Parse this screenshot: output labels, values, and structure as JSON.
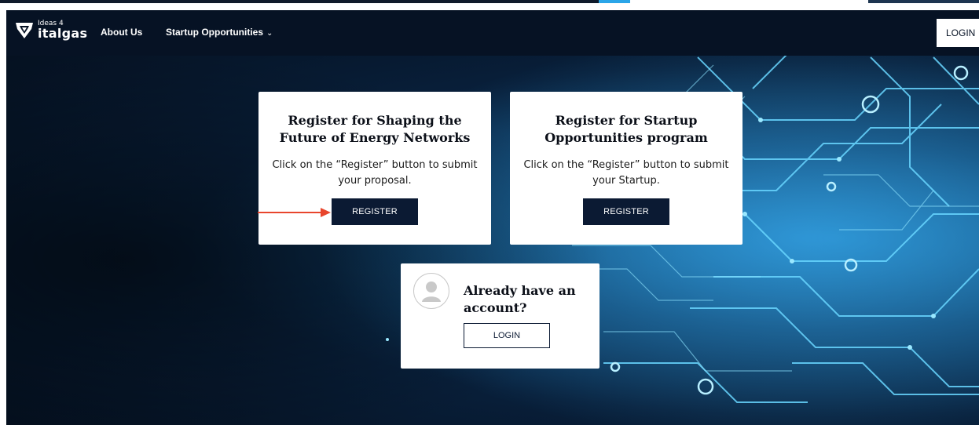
{
  "brand": {
    "logo_small": "Ideas 4",
    "logo_main": "italgas"
  },
  "nav": {
    "about": "About Us",
    "startup": "Startup Opportunities",
    "startup_caret": "⌄",
    "login": "LOGIN"
  },
  "cards": [
    {
      "title": "Register for Shaping the Future of Energy Networks",
      "description": "Click on the “Register” button to submit your proposal.",
      "button": "REGISTER"
    },
    {
      "title": "Register for Startup Opportunities program",
      "description": "Click on the “Register” button to submit your Startup.",
      "button": "REGISTER"
    }
  ],
  "account": {
    "title": "Already have an account?",
    "button": "LOGIN"
  },
  "colors": {
    "navbar": "#061224",
    "button_dark": "#0b1a33",
    "arrow": "#e8452c",
    "circuit_glow": "#5fd4ff"
  }
}
